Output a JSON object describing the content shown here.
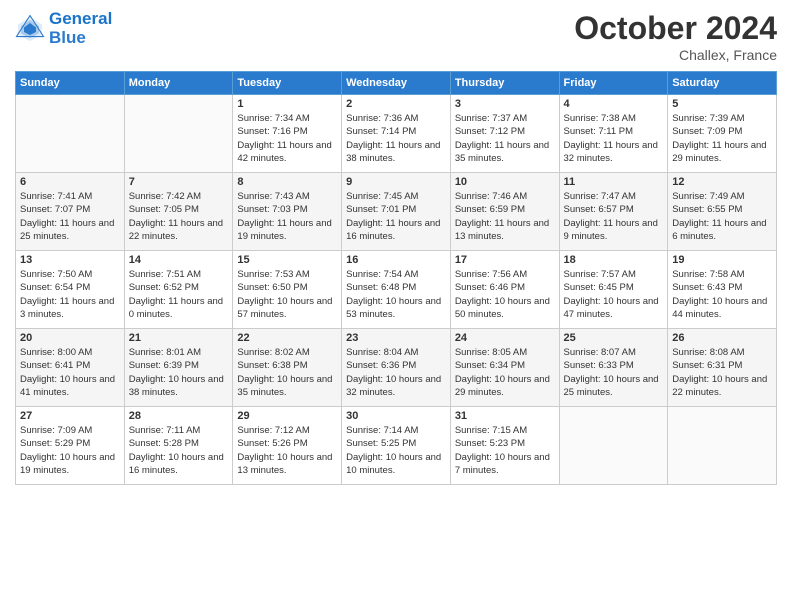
{
  "header": {
    "logo_line1": "General",
    "logo_line2": "Blue",
    "month": "October 2024",
    "location": "Challex, France"
  },
  "weekdays": [
    "Sunday",
    "Monday",
    "Tuesday",
    "Wednesday",
    "Thursday",
    "Friday",
    "Saturday"
  ],
  "weeks": [
    [
      {
        "day": "",
        "sunrise": "",
        "sunset": "",
        "daylight": ""
      },
      {
        "day": "",
        "sunrise": "",
        "sunset": "",
        "daylight": ""
      },
      {
        "day": "1",
        "sunrise": "Sunrise: 7:34 AM",
        "sunset": "Sunset: 7:16 PM",
        "daylight": "Daylight: 11 hours and 42 minutes."
      },
      {
        "day": "2",
        "sunrise": "Sunrise: 7:36 AM",
        "sunset": "Sunset: 7:14 PM",
        "daylight": "Daylight: 11 hours and 38 minutes."
      },
      {
        "day": "3",
        "sunrise": "Sunrise: 7:37 AM",
        "sunset": "Sunset: 7:12 PM",
        "daylight": "Daylight: 11 hours and 35 minutes."
      },
      {
        "day": "4",
        "sunrise": "Sunrise: 7:38 AM",
        "sunset": "Sunset: 7:11 PM",
        "daylight": "Daylight: 11 hours and 32 minutes."
      },
      {
        "day": "5",
        "sunrise": "Sunrise: 7:39 AM",
        "sunset": "Sunset: 7:09 PM",
        "daylight": "Daylight: 11 hours and 29 minutes."
      }
    ],
    [
      {
        "day": "6",
        "sunrise": "Sunrise: 7:41 AM",
        "sunset": "Sunset: 7:07 PM",
        "daylight": "Daylight: 11 hours and 25 minutes."
      },
      {
        "day": "7",
        "sunrise": "Sunrise: 7:42 AM",
        "sunset": "Sunset: 7:05 PM",
        "daylight": "Daylight: 11 hours and 22 minutes."
      },
      {
        "day": "8",
        "sunrise": "Sunrise: 7:43 AM",
        "sunset": "Sunset: 7:03 PM",
        "daylight": "Daylight: 11 hours and 19 minutes."
      },
      {
        "day": "9",
        "sunrise": "Sunrise: 7:45 AM",
        "sunset": "Sunset: 7:01 PM",
        "daylight": "Daylight: 11 hours and 16 minutes."
      },
      {
        "day": "10",
        "sunrise": "Sunrise: 7:46 AM",
        "sunset": "Sunset: 6:59 PM",
        "daylight": "Daylight: 11 hours and 13 minutes."
      },
      {
        "day": "11",
        "sunrise": "Sunrise: 7:47 AM",
        "sunset": "Sunset: 6:57 PM",
        "daylight": "Daylight: 11 hours and 9 minutes."
      },
      {
        "day": "12",
        "sunrise": "Sunrise: 7:49 AM",
        "sunset": "Sunset: 6:55 PM",
        "daylight": "Daylight: 11 hours and 6 minutes."
      }
    ],
    [
      {
        "day": "13",
        "sunrise": "Sunrise: 7:50 AM",
        "sunset": "Sunset: 6:54 PM",
        "daylight": "Daylight: 11 hours and 3 minutes."
      },
      {
        "day": "14",
        "sunrise": "Sunrise: 7:51 AM",
        "sunset": "Sunset: 6:52 PM",
        "daylight": "Daylight: 11 hours and 0 minutes."
      },
      {
        "day": "15",
        "sunrise": "Sunrise: 7:53 AM",
        "sunset": "Sunset: 6:50 PM",
        "daylight": "Daylight: 10 hours and 57 minutes."
      },
      {
        "day": "16",
        "sunrise": "Sunrise: 7:54 AM",
        "sunset": "Sunset: 6:48 PM",
        "daylight": "Daylight: 10 hours and 53 minutes."
      },
      {
        "day": "17",
        "sunrise": "Sunrise: 7:56 AM",
        "sunset": "Sunset: 6:46 PM",
        "daylight": "Daylight: 10 hours and 50 minutes."
      },
      {
        "day": "18",
        "sunrise": "Sunrise: 7:57 AM",
        "sunset": "Sunset: 6:45 PM",
        "daylight": "Daylight: 10 hours and 47 minutes."
      },
      {
        "day": "19",
        "sunrise": "Sunrise: 7:58 AM",
        "sunset": "Sunset: 6:43 PM",
        "daylight": "Daylight: 10 hours and 44 minutes."
      }
    ],
    [
      {
        "day": "20",
        "sunrise": "Sunrise: 8:00 AM",
        "sunset": "Sunset: 6:41 PM",
        "daylight": "Daylight: 10 hours and 41 minutes."
      },
      {
        "day": "21",
        "sunrise": "Sunrise: 8:01 AM",
        "sunset": "Sunset: 6:39 PM",
        "daylight": "Daylight: 10 hours and 38 minutes."
      },
      {
        "day": "22",
        "sunrise": "Sunrise: 8:02 AM",
        "sunset": "Sunset: 6:38 PM",
        "daylight": "Daylight: 10 hours and 35 minutes."
      },
      {
        "day": "23",
        "sunrise": "Sunrise: 8:04 AM",
        "sunset": "Sunset: 6:36 PM",
        "daylight": "Daylight: 10 hours and 32 minutes."
      },
      {
        "day": "24",
        "sunrise": "Sunrise: 8:05 AM",
        "sunset": "Sunset: 6:34 PM",
        "daylight": "Daylight: 10 hours and 29 minutes."
      },
      {
        "day": "25",
        "sunrise": "Sunrise: 8:07 AM",
        "sunset": "Sunset: 6:33 PM",
        "daylight": "Daylight: 10 hours and 25 minutes."
      },
      {
        "day": "26",
        "sunrise": "Sunrise: 8:08 AM",
        "sunset": "Sunset: 6:31 PM",
        "daylight": "Daylight: 10 hours and 22 minutes."
      }
    ],
    [
      {
        "day": "27",
        "sunrise": "Sunrise: 7:09 AM",
        "sunset": "Sunset: 5:29 PM",
        "daylight": "Daylight: 10 hours and 19 minutes."
      },
      {
        "day": "28",
        "sunrise": "Sunrise: 7:11 AM",
        "sunset": "Sunset: 5:28 PM",
        "daylight": "Daylight: 10 hours and 16 minutes."
      },
      {
        "day": "29",
        "sunrise": "Sunrise: 7:12 AM",
        "sunset": "Sunset: 5:26 PM",
        "daylight": "Daylight: 10 hours and 13 minutes."
      },
      {
        "day": "30",
        "sunrise": "Sunrise: 7:14 AM",
        "sunset": "Sunset: 5:25 PM",
        "daylight": "Daylight: 10 hours and 10 minutes."
      },
      {
        "day": "31",
        "sunrise": "Sunrise: 7:15 AM",
        "sunset": "Sunset: 5:23 PM",
        "daylight": "Daylight: 10 hours and 7 minutes."
      },
      {
        "day": "",
        "sunrise": "",
        "sunset": "",
        "daylight": ""
      },
      {
        "day": "",
        "sunrise": "",
        "sunset": "",
        "daylight": ""
      }
    ]
  ]
}
